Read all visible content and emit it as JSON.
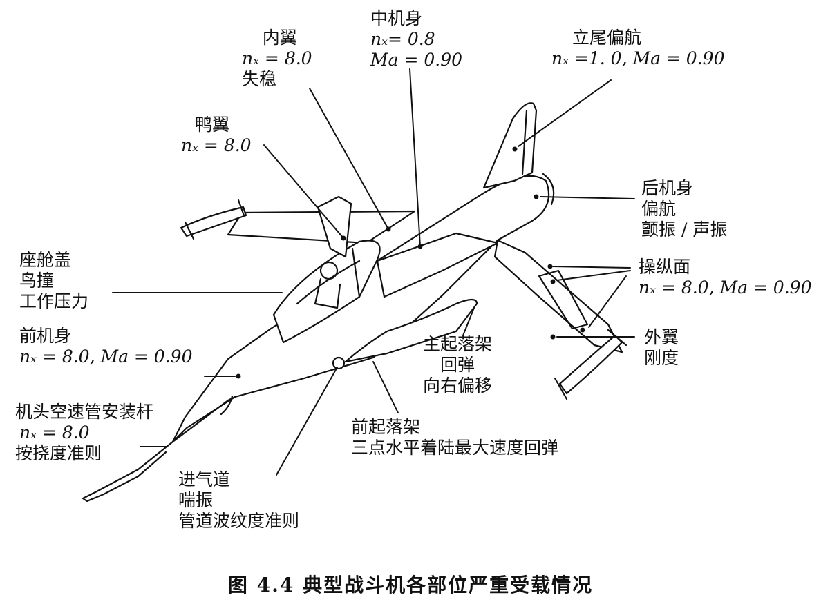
{
  "labels": {
    "inner_wing": {
      "l1": "内翼",
      "l2": "nₓ = 8.0",
      "l3": "失稳"
    },
    "mid_fuselage": {
      "l1": "中机身",
      "l2": "nₓ= 0.8",
      "l3": "Ma = 0.90"
    },
    "fin_yaw": {
      "l1": "立尾偏航",
      "l2": "nₓ =1. 0,  Ma = 0.90"
    },
    "canard": {
      "l1": "鸭翼",
      "l2": "nₓ = 8.0"
    },
    "aft_fuselage": {
      "l1": "后机身",
      "l2": "偏航",
      "l3": "颤振 / 声振"
    },
    "canopy": {
      "l1": "座舱盖",
      "l2": "鸟撞",
      "l3": "工作压力"
    },
    "control_surf": {
      "l1": "操纵面",
      "l2": "nₓ = 8.0, Ma = 0.90"
    },
    "front_fuse": {
      "l1": "前机身",
      "l2": "nₓ = 8.0,  Ma = 0.90"
    },
    "outer_wing": {
      "l1": "外翼",
      "l2": "刚度"
    },
    "main_gear": {
      "l1": "主起落架",
      "l2": "回弹",
      "l3": "向右偏移"
    },
    "pitot_boom": {
      "l1": "机头空速管安装杆",
      "l2": "nₓ = 8.0",
      "l3": "按挠度准则"
    },
    "nose_gear": {
      "l1": "前起落架",
      "l2": "三点水平着陆最大速度回弹"
    },
    "intake": {
      "l1": "进气道",
      "l2": "喘振",
      "l3": "管道波纹度准则"
    }
  },
  "caption": "图 4.4    典型战斗机各部位严重受载情况",
  "colors": {
    "ink": "#111111",
    "background": "#ffffff"
  }
}
